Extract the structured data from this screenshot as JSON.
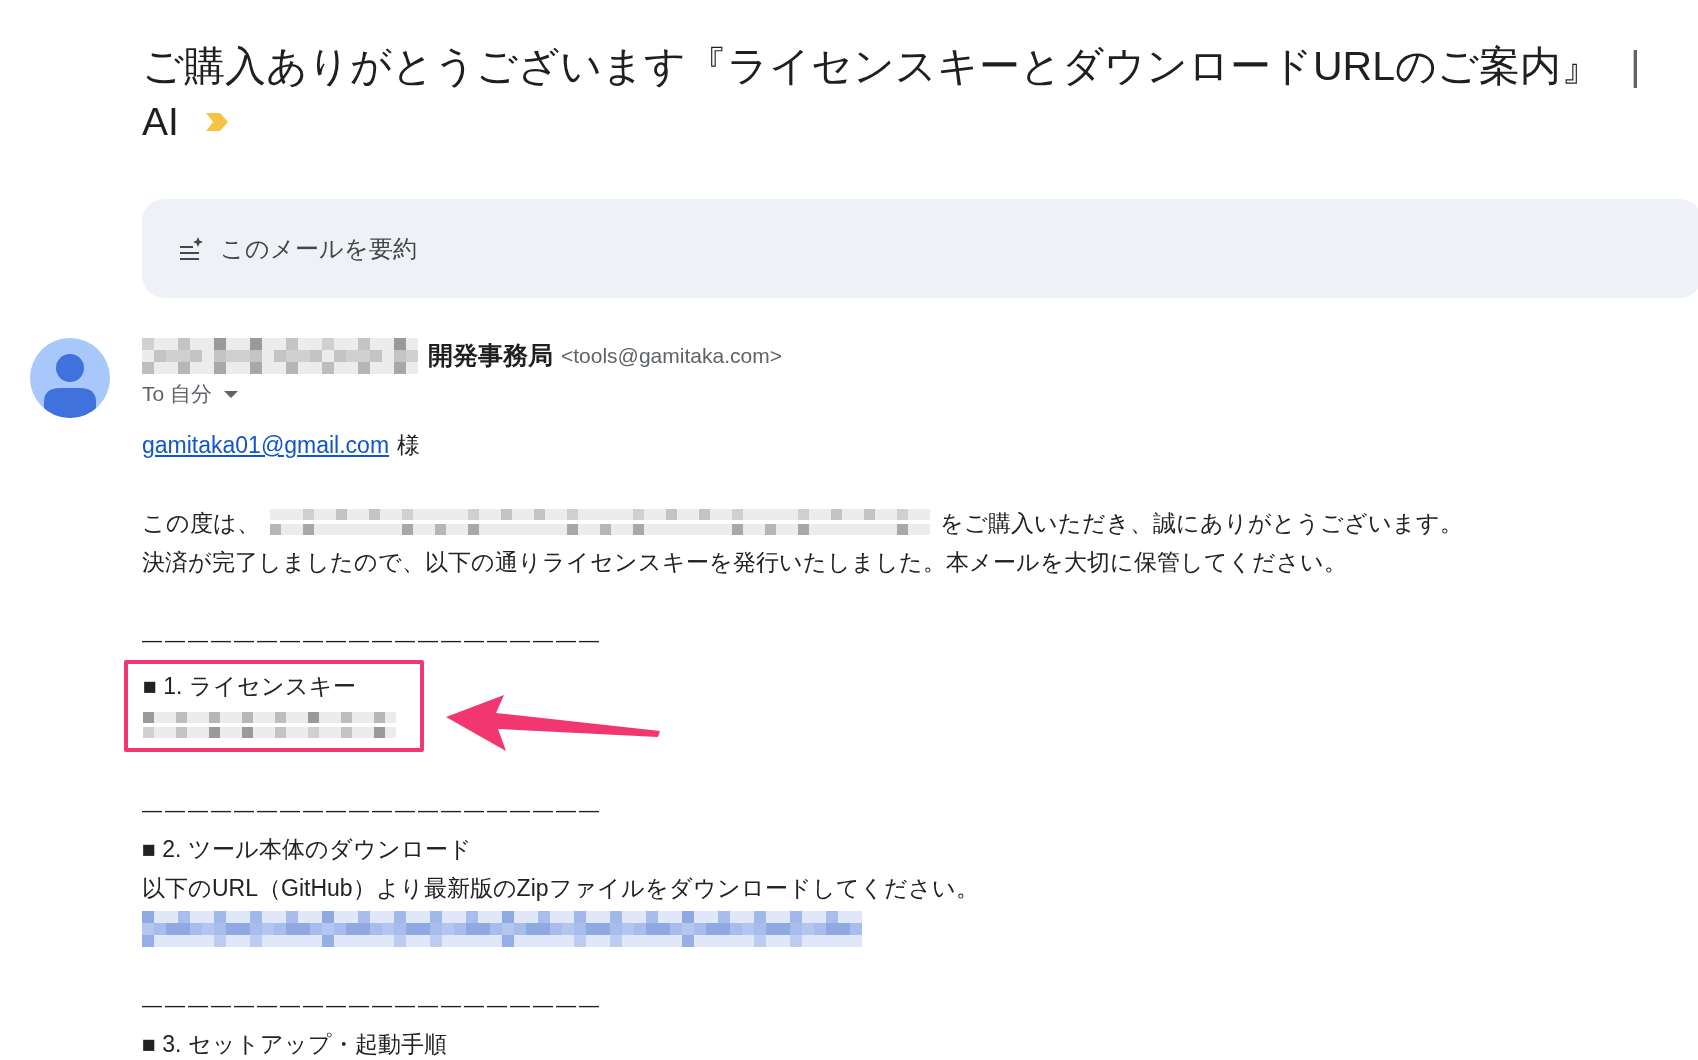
{
  "subject": {
    "lines": [
      "ご購入ありがとうございます『ライセンスキーとダウンロードURLのご案内』",
      "AI"
    ],
    "separator": "|",
    "important": true
  },
  "summarize_button": {
    "label": "このメールを要約"
  },
  "sender": {
    "name": "開発事務局",
    "email": "<tools@gamitaka.com>",
    "recipient": "To 自分"
  },
  "body": {
    "greeting": {
      "link": "gamitaka01@gmail.com",
      "suffix": "様"
    },
    "intro": {
      "before": "この度は、",
      "after": "をご購入いただき、誠にありがとうございます。"
    },
    "line2": "決済が完了しましたので、以下の通りライセンスキーを発行いたしました。本メールを大切に保管してください。",
    "sections": [
      {
        "divider": "————————————————————",
        "heading": "■ 1. ライセンスキー",
        "kind": "key",
        "highlighted": true
      },
      {
        "divider": "————————————————————",
        "heading": "■ 2. ツール本体のダウンロード",
        "kind": "download",
        "text": "以下のURL（GitHub）より最新版のZipファイルをダウンロードしてください。",
        "highlighted": false
      },
      {
        "divider": "————————————————————",
        "heading": "■ 3. セットアップ・起動手順",
        "kind": "plain",
        "highlighted": false
      }
    ]
  }
}
